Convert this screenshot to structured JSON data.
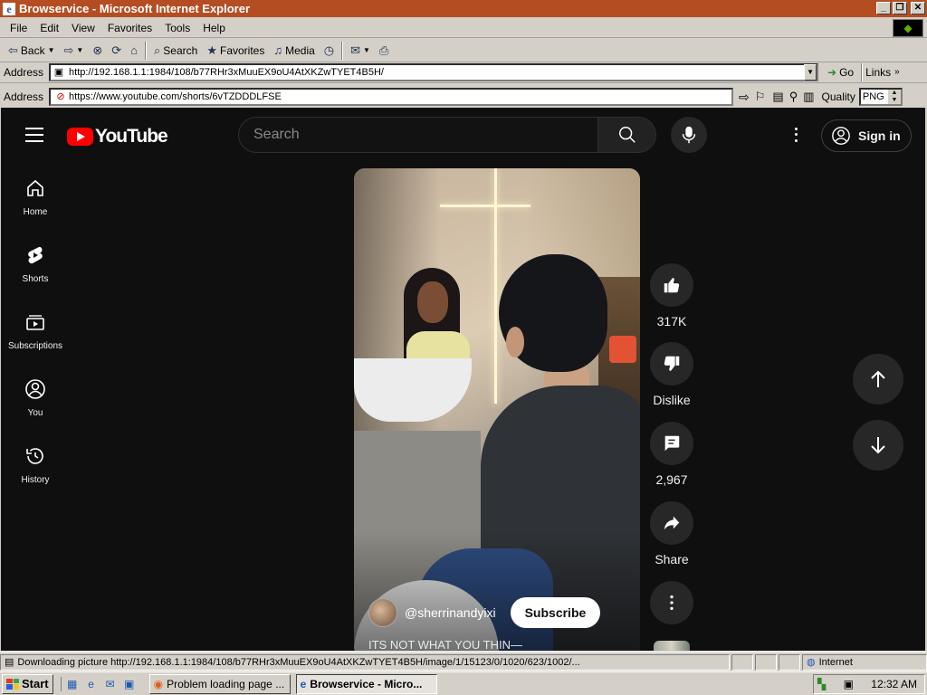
{
  "window": {
    "title": "Browservice - Microsoft Internet Explorer",
    "buttons": [
      "_",
      "❐",
      "✕"
    ]
  },
  "menu": [
    "File",
    "Edit",
    "View",
    "Favorites",
    "Tools",
    "Help"
  ],
  "toolbar": {
    "back": "Back",
    "search": "Search",
    "favorites": "Favorites",
    "media": "Media"
  },
  "ie_address": {
    "label": "Address",
    "url": "http://192.168.1.1:1984/108/b77RHr3xMuuEX9oU4AtXKZwTYET4B5H/",
    "go": "Go",
    "links": "Links"
  },
  "browservice_address": {
    "label": "Address",
    "url": "https://www.youtube.com/shorts/6vTZDDDLFSE",
    "quality_label": "Quality",
    "quality_value": "PNG"
  },
  "youtube": {
    "logo_text": "YouTube",
    "search_placeholder": "Search",
    "signin": "Sign in",
    "sidebar": [
      {
        "label": "Home",
        "icon": "home-icon"
      },
      {
        "label": "Shorts",
        "icon": "shorts-icon"
      },
      {
        "label": "Subscriptions",
        "icon": "subscriptions-icon"
      },
      {
        "label": "You",
        "icon": "you-icon"
      },
      {
        "label": "History",
        "icon": "history-icon"
      }
    ],
    "video": {
      "channel": "@sherrinandyixi",
      "subscribe": "Subscribe",
      "caption": "ITS NOT WHAT YOU THIN—"
    },
    "actions": {
      "likes": "317K",
      "dislike": "Dislike",
      "comments": "2,967",
      "share": "Share"
    }
  },
  "status": {
    "text": "Downloading picture http://192.168.1.1:1984/108/b77RHr3xMuuEX9oU4AtXKZwTYET4B5H/image/1/15123/0/1020/623/1002/...",
    "zone": "Internet"
  },
  "taskbar": {
    "start": "Start",
    "tasks": [
      "Problem loading page ...",
      "Browservice - Micro..."
    ],
    "clock": "12:32 AM"
  },
  "colors": {
    "titlebar": "#b54d23",
    "youtube_bg": "#0f0f0f",
    "youtube_red": "#ff0000"
  }
}
